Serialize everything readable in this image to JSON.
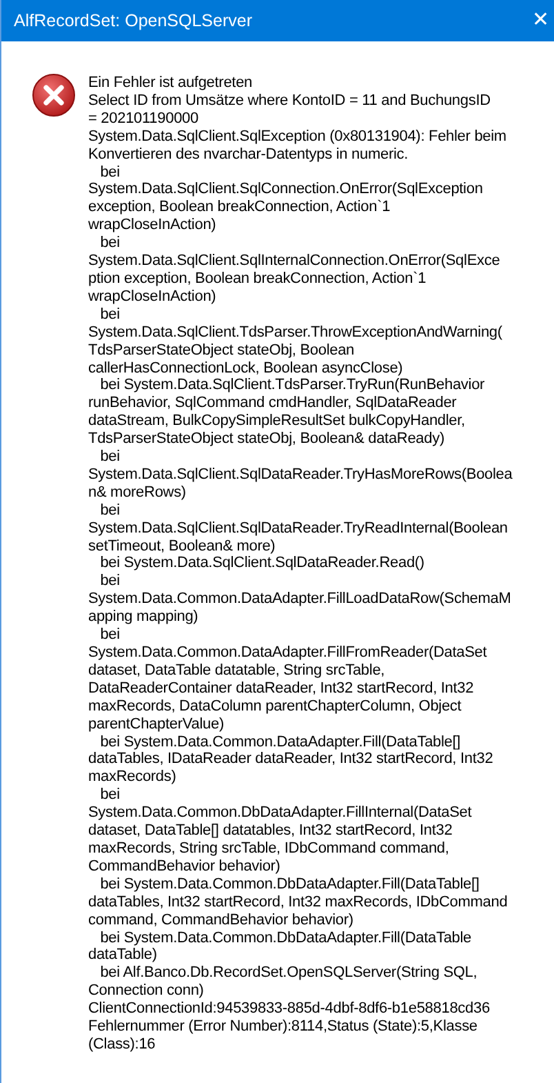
{
  "window": {
    "title": "AlfRecordSet: OpenSQLServer",
    "close_glyph": "✕"
  },
  "message": {
    "lines": [
      "Ein Fehler ist aufgetreten",
      "Select ID from Umsätze where KontoID = 11 and BuchungsID",
      "= 202101190000",
      "System.Data.SqlClient.SqlException (0x80131904): Fehler beim",
      "Konvertieren des nvarchar-Datentyps in numeric.",
      "   bei",
      "System.Data.SqlClient.SqlConnection.OnError(SqlException",
      "exception, Boolean breakConnection, Action`1",
      "wrapCloseInAction)",
      "   bei",
      "System.Data.SqlClient.SqlInternalConnection.OnError(SqlExce",
      "ption exception, Boolean breakConnection, Action`1",
      "wrapCloseInAction)",
      "   bei",
      "System.Data.SqlClient.TdsParser.ThrowExceptionAndWarning(",
      "TdsParserStateObject stateObj, Boolean",
      "callerHasConnectionLock, Boolean asyncClose)",
      "   bei System.Data.SqlClient.TdsParser.TryRun(RunBehavior",
      "runBehavior, SqlCommand cmdHandler, SqlDataReader",
      "dataStream, BulkCopySimpleResultSet bulkCopyHandler,",
      "TdsParserStateObject stateObj, Boolean& dataReady)",
      "   bei",
      "System.Data.SqlClient.SqlDataReader.TryHasMoreRows(Boolea",
      "n& moreRows)",
      "   bei",
      "System.Data.SqlClient.SqlDataReader.TryReadInternal(Boolean",
      "setTimeout, Boolean& more)",
      "   bei System.Data.SqlClient.SqlDataReader.Read()",
      "   bei",
      "System.Data.Common.DataAdapter.FillLoadDataRow(SchemaM",
      "apping mapping)",
      "   bei",
      "System.Data.Common.DataAdapter.FillFromReader(DataSet",
      "dataset, DataTable datatable, String srcTable,",
      "DataReaderContainer dataReader, Int32 startRecord, Int32",
      "maxRecords, DataColumn parentChapterColumn, Object",
      "parentChapterValue)",
      "   bei System.Data.Common.DataAdapter.Fill(DataTable[]",
      "dataTables, IDataReader dataReader, Int32 startRecord, Int32",
      "maxRecords)",
      "   bei",
      "System.Data.Common.DbDataAdapter.FillInternal(DataSet",
      "dataset, DataTable[] datatables, Int32 startRecord, Int32",
      "maxRecords, String srcTable, IDbCommand command,",
      "CommandBehavior behavior)",
      "   bei System.Data.Common.DbDataAdapter.Fill(DataTable[]",
      "dataTables, Int32 startRecord, Int32 maxRecords, IDbCommand",
      "command, CommandBehavior behavior)",
      "   bei System.Data.Common.DbDataAdapter.Fill(DataTable",
      "dataTable)",
      "   bei Alf.Banco.Db.RecordSet.OpenSQLServer(String SQL,",
      "Connection conn)",
      "ClientConnectionId:94539833-885d-4dbf-8df6-b1e58818cd36",
      "Fehlernummer (Error Number):8114,Status (State):5,Klasse",
      "(Class):16"
    ]
  }
}
